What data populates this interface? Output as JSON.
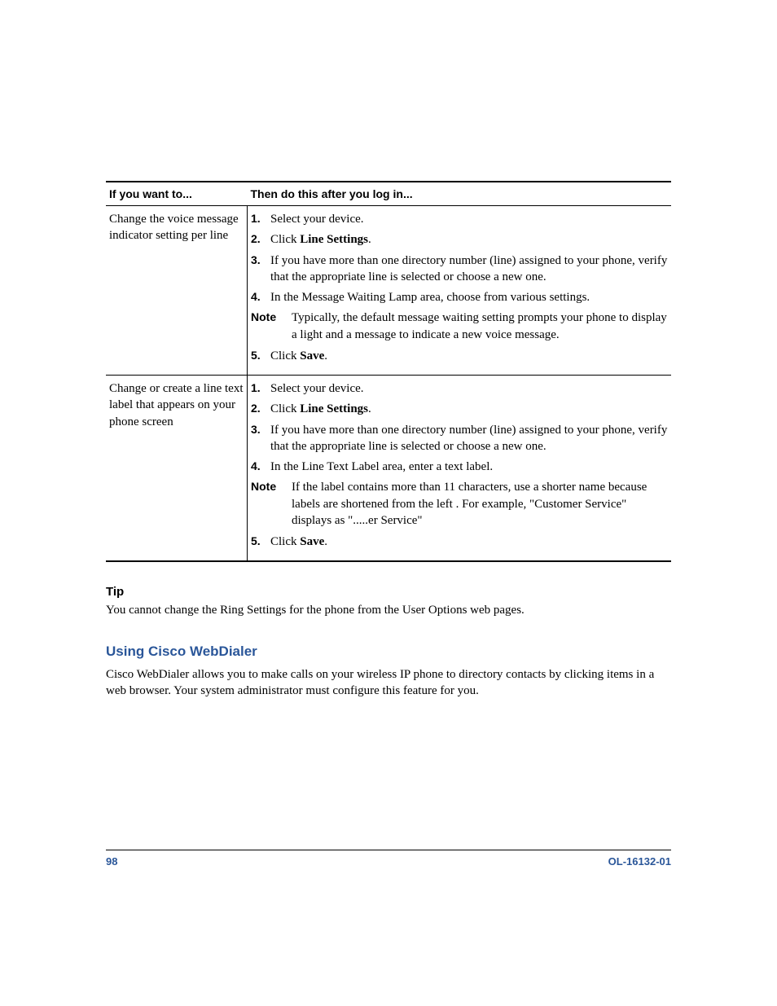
{
  "table": {
    "headers": [
      "If you want to...",
      "Then do this after you log in..."
    ],
    "rows": [
      {
        "left": "Change the voice message indicator setting per line",
        "steps": [
          {
            "n": "1.",
            "pre": "Select your device."
          },
          {
            "n": "2.",
            "pre": "Click ",
            "bold": "Line Settings",
            "post": "."
          },
          {
            "n": "3.",
            "pre": "If you have more than one directory number (line) assigned to your phone, verify that the appropriate line is selected or choose a new one."
          },
          {
            "n": "4.",
            "pre": "In the Message Waiting Lamp area, choose from various settings."
          }
        ],
        "note": {
          "label": "Note",
          "text": "Typically, the default message waiting setting prompts your phone to display a light and a message to indicate a new voice message."
        },
        "after": [
          {
            "n": "5.",
            "pre": "Click ",
            "bold": "Save",
            "post": "."
          }
        ]
      },
      {
        "left": "Change or create a line text label that appears on your phone screen",
        "steps": [
          {
            "n": "1.",
            "pre": "Select your device."
          },
          {
            "n": "2.",
            "pre": "Click ",
            "bold": "Line Settings",
            "post": "."
          },
          {
            "n": "3.",
            "pre": "If you have more than one directory number (line) assigned to your phone, verify that the appropriate line is selected or choose a new one."
          },
          {
            "n": "4.",
            "pre": "In the Line Text Label area, enter a text label."
          }
        ],
        "note": {
          "label": "Note",
          "text": "If the label contains more than 11 characters, use a shorter name because labels are shortened from the left . For example, \"Customer Service\" displays as \".....er Service\""
        },
        "after": [
          {
            "n": "5.",
            "pre": "Click ",
            "bold": "Save",
            "post": "."
          }
        ]
      }
    ]
  },
  "tip": {
    "heading": "Tip",
    "body": "You cannot change the Ring Settings for the phone from the User Options web pages."
  },
  "section": {
    "heading": "Using Cisco WebDialer",
    "body": "Cisco WebDialer allows you to make calls on your wireless IP phone to directory contacts by clicking items in a web browser. Your system administrator must configure this feature for you."
  },
  "footer": {
    "page": "98",
    "doc": "OL-16132-01"
  }
}
